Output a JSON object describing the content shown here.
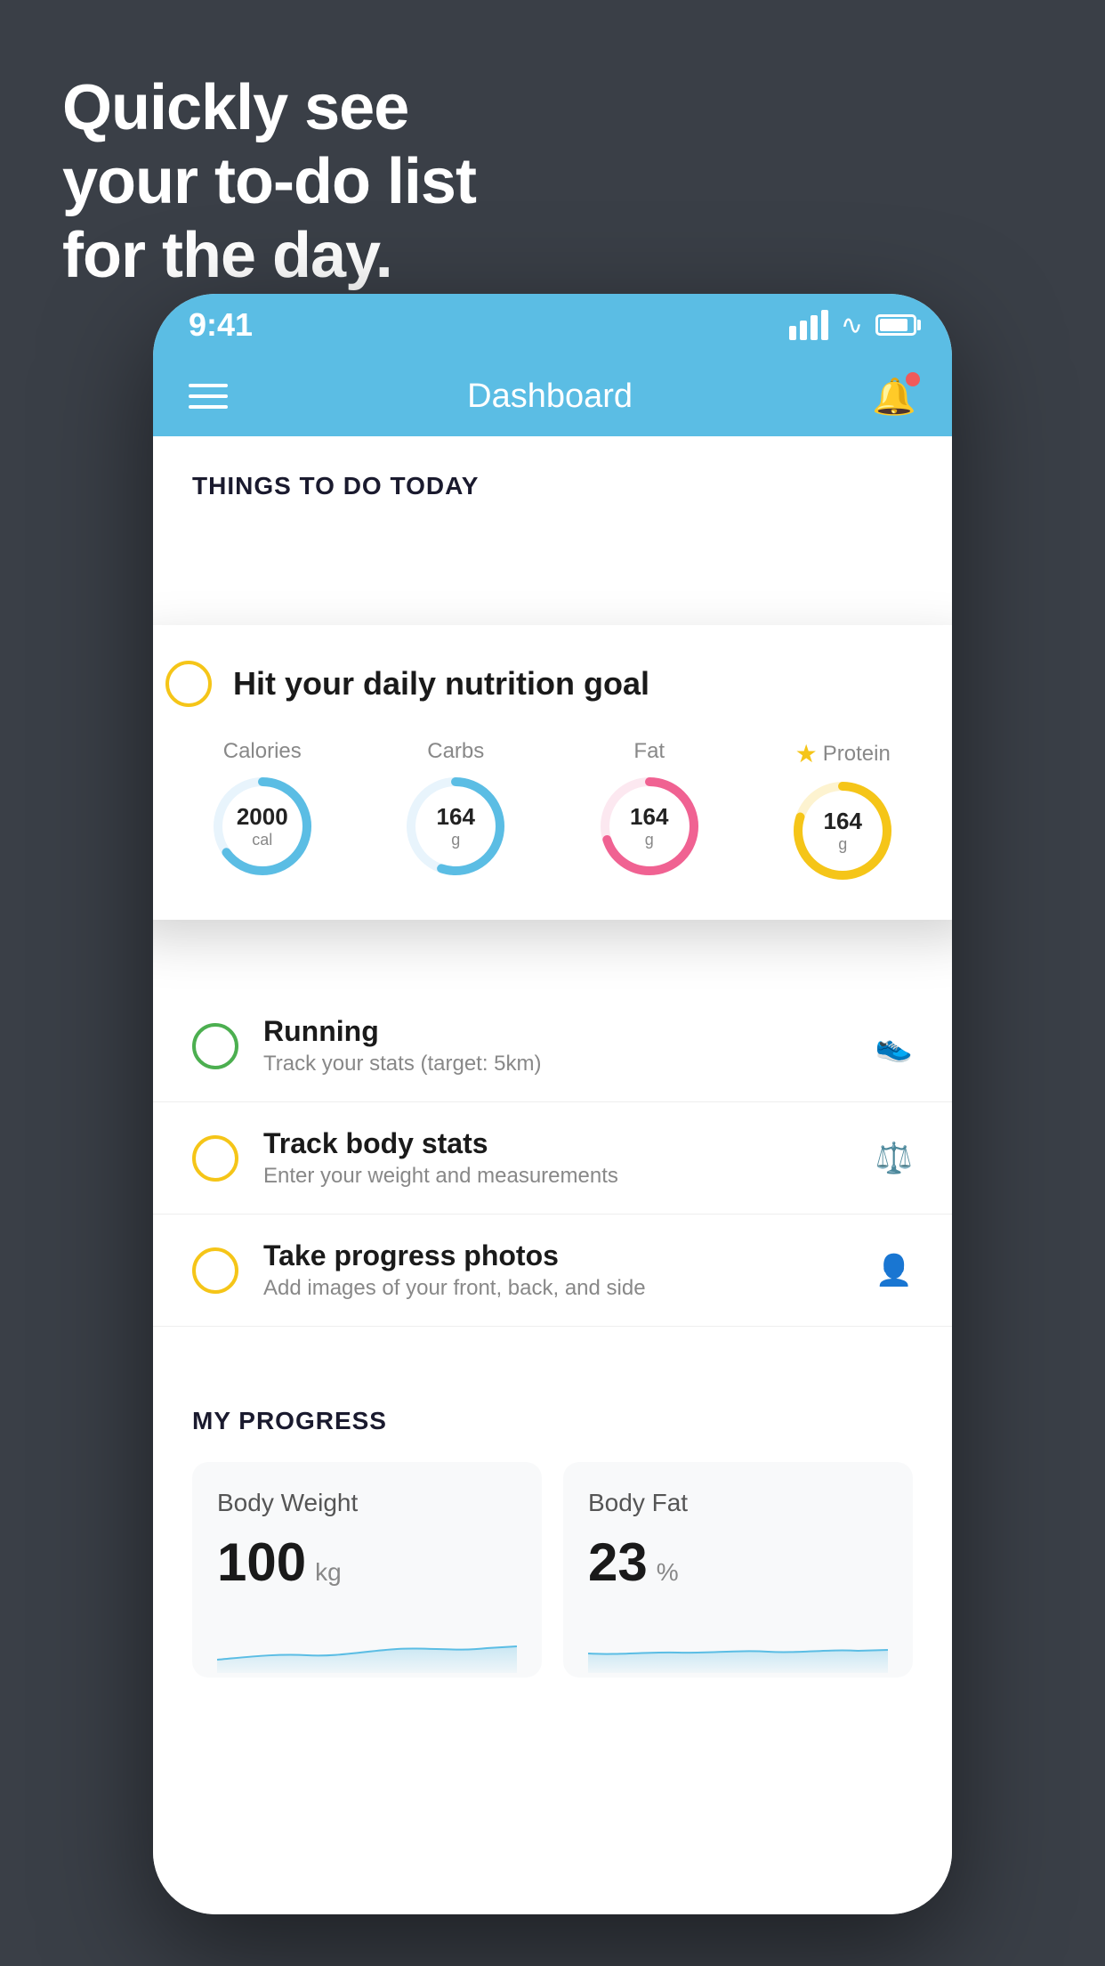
{
  "hero": {
    "line1": "Quickly see",
    "line2": "your to-do list",
    "line3": "for the day."
  },
  "statusBar": {
    "time": "9:41"
  },
  "navBar": {
    "title": "Dashboard"
  },
  "thingsToDo": {
    "sectionLabel": "THINGS TO DO TODAY"
  },
  "nutritionCard": {
    "title": "Hit your daily nutrition goal",
    "items": [
      {
        "label": "Calories",
        "value": "2000",
        "unit": "cal",
        "color": "#5bbde4",
        "pct": 65
      },
      {
        "label": "Carbs",
        "value": "164",
        "unit": "g",
        "color": "#5bbde4",
        "pct": 55
      },
      {
        "label": "Fat",
        "value": "164",
        "unit": "g",
        "color": "#f06292",
        "pct": 70
      },
      {
        "label": "Protein",
        "value": "164",
        "unit": "g",
        "color": "#f5c518",
        "pct": 80,
        "star": true
      }
    ]
  },
  "todoItems": [
    {
      "title": "Running",
      "sub": "Track your stats (target: 5km)",
      "circleColor": "green",
      "icon": "👟"
    },
    {
      "title": "Track body stats",
      "sub": "Enter your weight and measurements",
      "circleColor": "yellow",
      "icon": "⚖️"
    },
    {
      "title": "Take progress photos",
      "sub": "Add images of your front, back, and side",
      "circleColor": "yellow",
      "icon": "👤"
    }
  ],
  "progress": {
    "sectionLabel": "MY PROGRESS",
    "cards": [
      {
        "title": "Body Weight",
        "value": "100",
        "unit": "kg"
      },
      {
        "title": "Body Fat",
        "value": "23",
        "unit": "%"
      }
    ]
  }
}
